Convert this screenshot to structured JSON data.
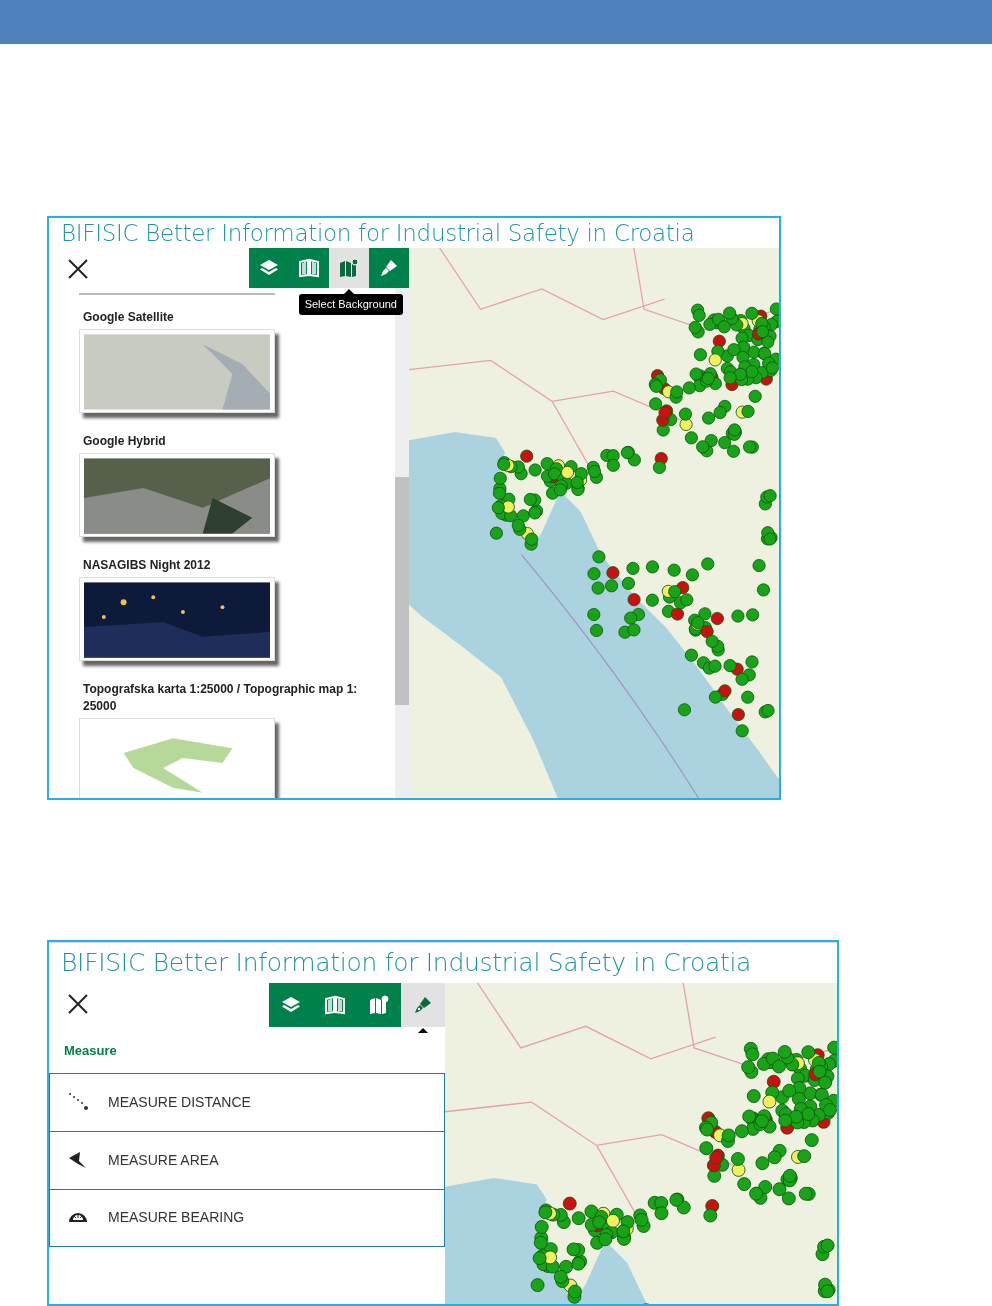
{
  "screenshots": [
    {
      "title": "BIFISIC Better Information for Industrial Safety in Croatia",
      "toolbar": [
        {
          "kind": "layers",
          "selected": false
        },
        {
          "kind": "book",
          "selected": false
        },
        {
          "kind": "map",
          "selected": true
        },
        {
          "kind": "pen",
          "selected": false
        }
      ],
      "tooltip": "Select Background",
      "panel": {
        "kind": "backgrounds",
        "items": [
          {
            "label": "Google Satellite",
            "kind": "unavailable"
          },
          {
            "label": "Google Hybrid",
            "kind": "satellite"
          },
          {
            "label": "NASAGIBS Night 2012",
            "kind": "night"
          },
          {
            "label": "Topografska karta 1:25000 / Topographic map 1: 25000",
            "kind": "topographic"
          }
        ]
      }
    },
    {
      "title": "BIFISIC Better Information for Industrial Safety in Croatia",
      "toolbar": [
        {
          "kind": "layers",
          "selected": false
        },
        {
          "kind": "book",
          "selected": false
        },
        {
          "kind": "map",
          "selected": false
        },
        {
          "kind": "pen",
          "selected": true
        }
      ],
      "panel": {
        "kind": "measure",
        "heading": "Measure",
        "items": [
          {
            "label": "MEASURE DISTANCE",
            "kind": "distance"
          },
          {
            "label": "MEASURE AREA",
            "kind": "area"
          },
          {
            "label": "MEASURE BEARING",
            "kind": "bearing"
          }
        ]
      }
    }
  ]
}
